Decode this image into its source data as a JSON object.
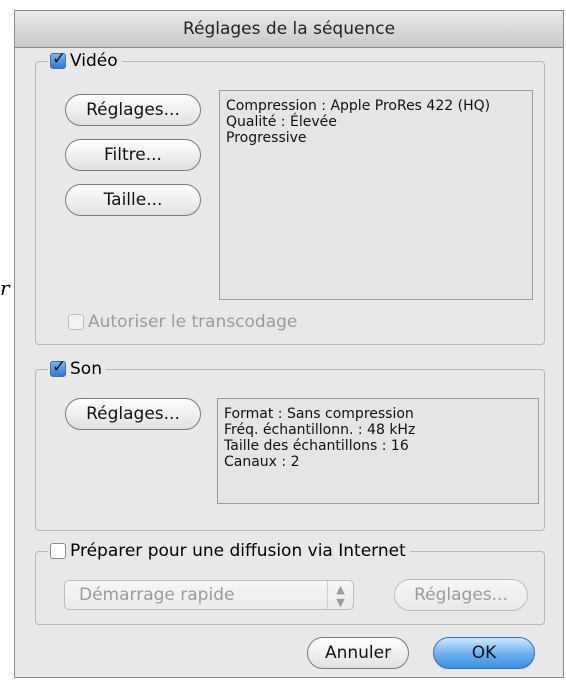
{
  "margin_glyph": "r",
  "window": {
    "title": "Réglages de la séquence"
  },
  "video": {
    "label": "Vidéo",
    "checked": true,
    "buttons": {
      "settings": "Réglages...",
      "filter": "Filtre...",
      "size": "Taille..."
    },
    "info": [
      "Compression : Apple ProRes 422 (HQ)",
      "Qualité : Élevée",
      "Progressive"
    ],
    "transcode_label": "Autoriser le transcodage",
    "transcode_checked": false
  },
  "audio": {
    "label": "Son",
    "checked": true,
    "buttons": {
      "settings": "Réglages..."
    },
    "info": [
      "Format : Sans compression",
      "Fréq. échantillonn. : 48 kHz",
      "Taille des échantillons : 16",
      "Canaux : 2"
    ]
  },
  "internet": {
    "label": "Préparer pour une diffusion via Internet",
    "checked": false,
    "popup_value": "Démarrage rapide",
    "settings_button": "Réglages..."
  },
  "footer": {
    "cancel": "Annuler",
    "ok": "OK"
  },
  "icons": {
    "popup_arrows": "up-down-arrows-icon",
    "checkmark": "checkmark-icon"
  },
  "colors": {
    "default_button": "#5aa2ea",
    "checkbox_checked": "#2f78d4",
    "disabled_text": "#9b9b9b"
  }
}
